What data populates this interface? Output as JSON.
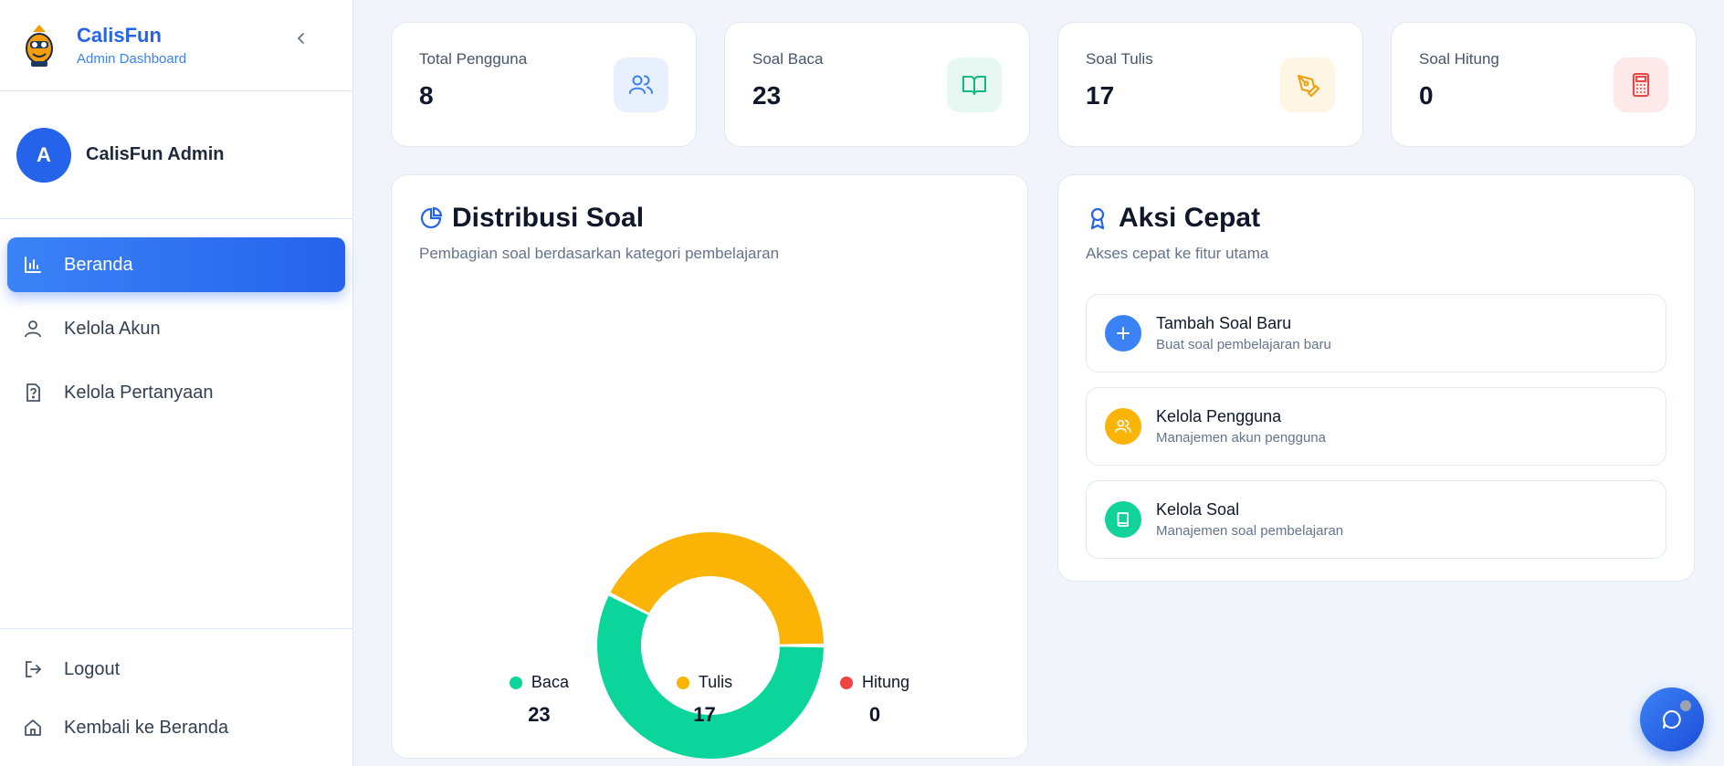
{
  "brand": {
    "name": "CalisFun",
    "subtitle": "Admin Dashboard"
  },
  "user": {
    "initial": "A",
    "name": "CalisFun Admin"
  },
  "nav": [
    {
      "label": "Beranda",
      "icon": "bar-chart-icon",
      "active": true
    },
    {
      "label": "Kelola Akun",
      "icon": "user-icon"
    },
    {
      "label": "Kelola Pertanyaan",
      "icon": "question-file-icon"
    }
  ],
  "footer_nav": [
    {
      "label": "Logout",
      "icon": "logout-icon"
    },
    {
      "label": "Kembali ke Beranda",
      "icon": "home-icon"
    }
  ],
  "stats": [
    {
      "label": "Total Pengguna",
      "value": "8",
      "icon": "users-icon",
      "color": "#3b82f6",
      "bg": "#e8f0fe"
    },
    {
      "label": "Soal Baca",
      "value": "23",
      "icon": "book-open-icon",
      "color": "#10b981",
      "bg": "#e6f8f1"
    },
    {
      "label": "Soal Tulis",
      "value": "17",
      "icon": "pen-tool-icon",
      "color": "#f59e0b",
      "bg": "#fef5e4"
    },
    {
      "label": "Soal Hitung",
      "value": "0",
      "icon": "calculator-icon",
      "color": "#ef4444",
      "bg": "#fde8ea"
    }
  ],
  "distribution": {
    "title": "Distribusi Soal",
    "subtitle": "Pembagian soal berdasarkan kategori pembelajaran"
  },
  "chart_data": {
    "type": "pie",
    "categories": [
      "Baca",
      "Tulis",
      "Hitung"
    ],
    "values": [
      23,
      17,
      0
    ],
    "colors": [
      "#0bd59b",
      "#fbb406",
      "#ef4444"
    ],
    "donut": true,
    "legend": "bottom"
  },
  "quick_actions": {
    "title": "Aksi Cepat",
    "subtitle": "Akses cepat ke fitur utama",
    "items": [
      {
        "title": "Tambah Soal Baru",
        "subtitle": "Buat soal pembelajaran baru",
        "icon": "plus-icon",
        "color": "#3b82f6"
      },
      {
        "title": "Kelola Pengguna",
        "subtitle": "Manajemen akun pengguna",
        "icon": "users-icon",
        "color": "#fbb406"
      },
      {
        "title": "Kelola Soal",
        "subtitle": "Manajemen soal pembelajaran",
        "icon": "book-icon",
        "color": "#10d29a"
      }
    ]
  }
}
